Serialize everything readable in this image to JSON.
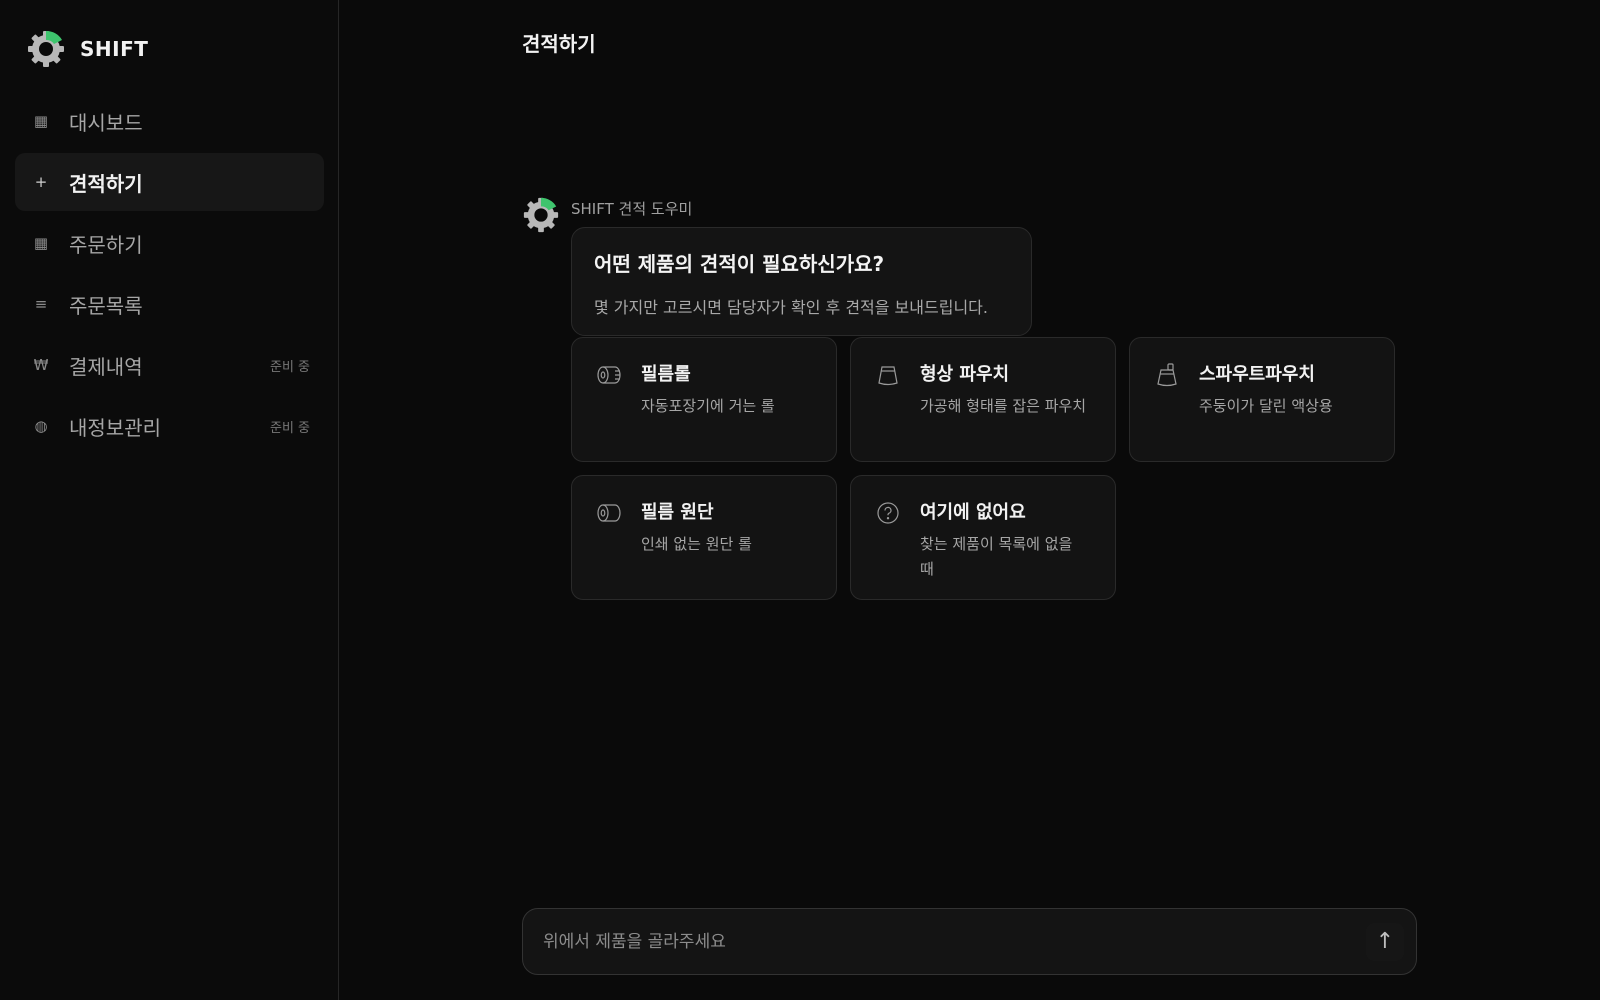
{
  "brand": {
    "name": "SHIFT"
  },
  "sidebar": {
    "items": [
      {
        "label": "대시보드",
        "icon": "▦",
        "badge": ""
      },
      {
        "label": "견적하기",
        "icon": "+",
        "badge": ""
      },
      {
        "label": "주문하기",
        "icon": "▦",
        "badge": ""
      },
      {
        "label": "주문목록",
        "icon": "≡",
        "badge": ""
      },
      {
        "label": "결제내역",
        "icon": "₩",
        "badge": "준비 중"
      },
      {
        "label": "내정보관리",
        "icon": "◍",
        "badge": "준비 중"
      }
    ]
  },
  "header": {
    "title": "견적하기"
  },
  "chat": {
    "bot_name": "SHIFT 견적 도우미",
    "question": "어떤 제품의 견적이 필요하신가요?",
    "subtext": "몇 가지만 고르시면 담당자가 확인 후 견적을 보내드립니다."
  },
  "options": [
    {
      "title": "필름롤",
      "desc": "자동포장기에 거는 롤",
      "icon": "film-roll-icon"
    },
    {
      "title": "형상 파우치",
      "desc": "가공해 형태를 잡은 파우치",
      "icon": "pouch-icon"
    },
    {
      "title": "스파우트파우치",
      "desc": "주둥이가 달린 액상용",
      "icon": "spout-pouch-icon"
    },
    {
      "title": "필름 원단",
      "desc": "인쇄 없는 원단 롤",
      "icon": "film-fabric-icon"
    },
    {
      "title": "여기에 없어요",
      "desc": "찾는 제품이 목록에 없을 때",
      "icon": "question-icon"
    }
  ],
  "composer": {
    "placeholder": "위에서 제품을 골라주세요",
    "send_icon": "↑"
  },
  "colors": {
    "background": "#0a0a0a",
    "accent": "#3ec46d",
    "logo": "#b8b8b8"
  }
}
